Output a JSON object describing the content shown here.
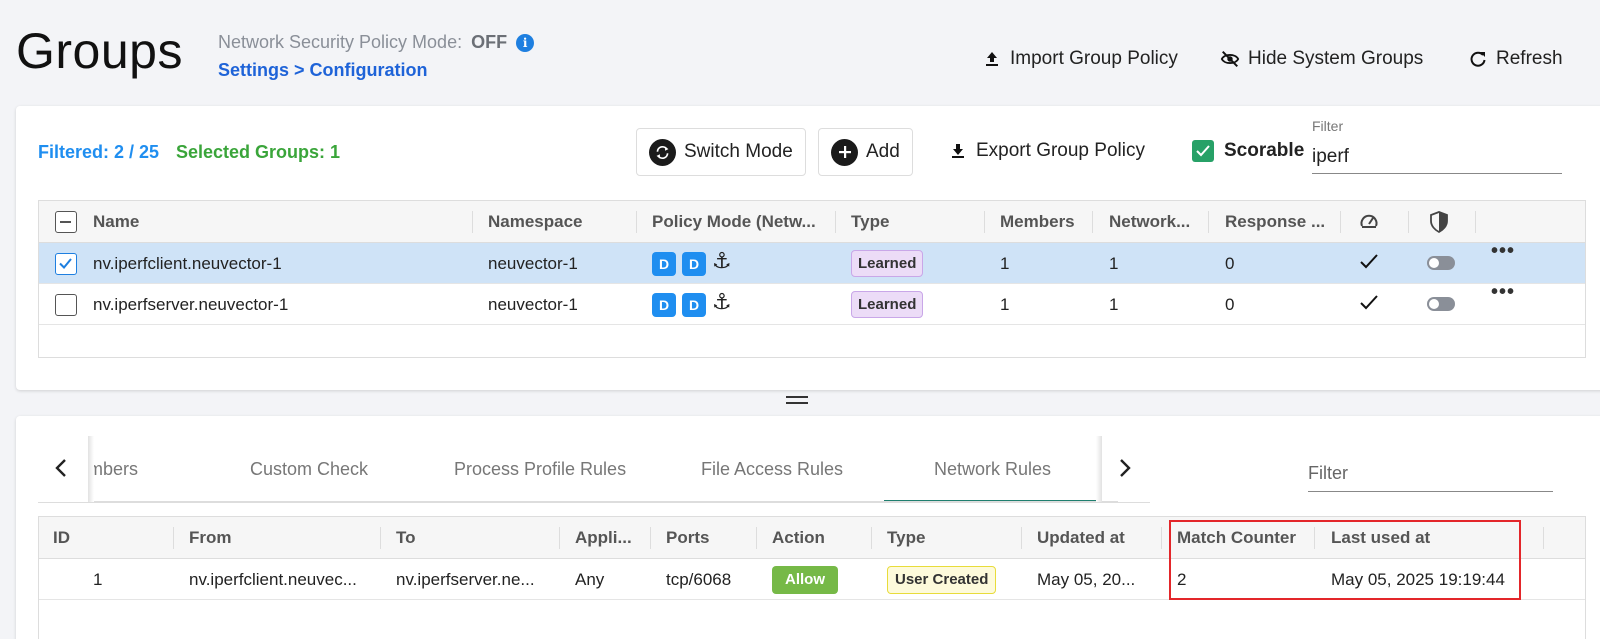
{
  "header": {
    "title": "Groups",
    "mode_label": "Network Security Policy Mode:",
    "mode_value": "OFF",
    "breadcrumb": "Settings > Configuration",
    "import_label": "Import Group Policy",
    "hide_label": "Hide System Groups",
    "refresh_label": "Refresh"
  },
  "toolbar": {
    "filtered": "Filtered: 2 / 25",
    "selected": "Selected Groups:  1",
    "switch_mode_label": "Switch Mode",
    "add_label": "Add",
    "export_label": "Export Group Policy",
    "scorable_label": "Scorable",
    "filter_label": "Filter",
    "filter_value": "iperf"
  },
  "groups": {
    "columns": [
      "Name",
      "Namespace",
      "Policy Mode (Netw...",
      "Type",
      "Members",
      "Network...",
      "Response ..."
    ],
    "rows": [
      {
        "name": "nv.iperfclient.neuvector-1",
        "namespace": "neuvector-1",
        "mode1": "D",
        "mode2": "D",
        "type": "Learned",
        "members": "1",
        "network": "1",
        "response": "0",
        "selected": true
      },
      {
        "name": "nv.iperfserver.neuvector-1",
        "namespace": "neuvector-1",
        "mode1": "D",
        "mode2": "D",
        "type": "Learned",
        "members": "1",
        "network": "1",
        "response": "0",
        "selected": false
      }
    ]
  },
  "tabs": [
    "mbers",
    "Custom Check",
    "Process Profile Rules",
    "File Access Rules",
    "Network Rules"
  ],
  "active_tab": "Network Rules",
  "rules_filter_placeholder": "Filter",
  "rules": {
    "columns": [
      "ID",
      "From",
      "To",
      "Appli...",
      "Ports",
      "Action",
      "Type",
      "Updated at",
      "Match Counter",
      "Last used at"
    ],
    "rows": [
      {
        "id": "1",
        "from": "nv.iperfclient.neuvec...",
        "to": "nv.iperfserver.ne...",
        "app": "Any",
        "ports": "tcp/6068",
        "action": "Allow",
        "type": "User Created",
        "updated": "May 05, 20...",
        "match": "2",
        "last_used": "May 05, 2025 19:19:44"
      }
    ]
  },
  "colors": {
    "accent": "#1f8ef0",
    "success": "#3aa53a",
    "highlight": "#e3262a"
  }
}
